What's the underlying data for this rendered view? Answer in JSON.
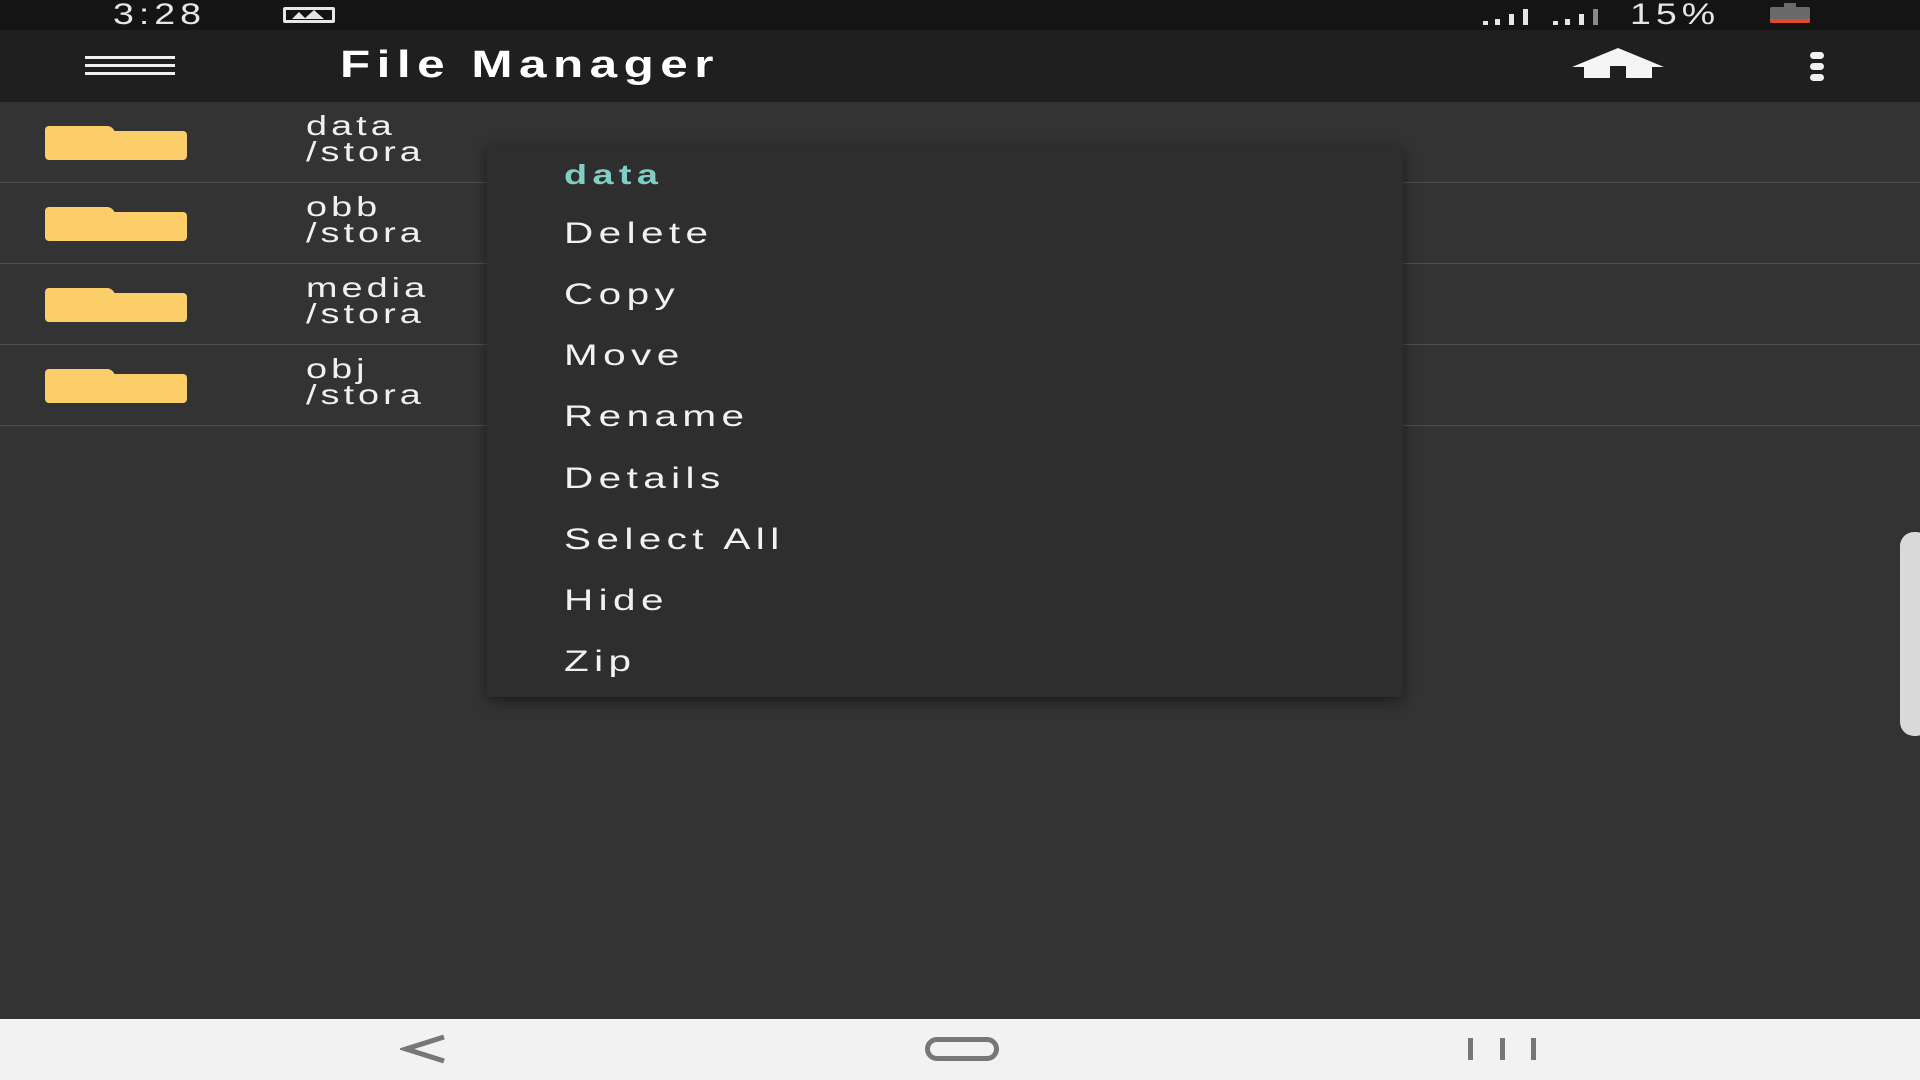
{
  "status_bar": {
    "time": "3:28",
    "battery": "15%",
    "icons": [
      "image-notification-icon",
      "signal-icon",
      "signal-icon",
      "battery-icon"
    ]
  },
  "toolbar": {
    "title": "File Manager",
    "icons": [
      "menu-icon",
      "home-icon",
      "more-vert-icon"
    ]
  },
  "files": [
    {
      "name": "data",
      "path": "/stora"
    },
    {
      "name": "obb",
      "path": "/stora"
    },
    {
      "name": "media",
      "path": "/stora"
    },
    {
      "name": "obj",
      "path": "/stora"
    }
  ],
  "context_menu": {
    "title": "data",
    "items": [
      "Delete",
      "Copy",
      "Move",
      "Rename",
      "Details",
      "Select All",
      "Hide",
      "Zip"
    ]
  },
  "nav_bar": {
    "icons": [
      "back-icon",
      "home-nav-icon",
      "recents-icon"
    ]
  },
  "colors": {
    "background": "#333333",
    "toolbar": "#1f1f1f",
    "status_bar": "#141414",
    "folder": "#fbce6a",
    "menu_title_accent": "#7fcfc4",
    "menu_background": "#2e2e2e",
    "nav_bar": "#f2f2f2"
  }
}
